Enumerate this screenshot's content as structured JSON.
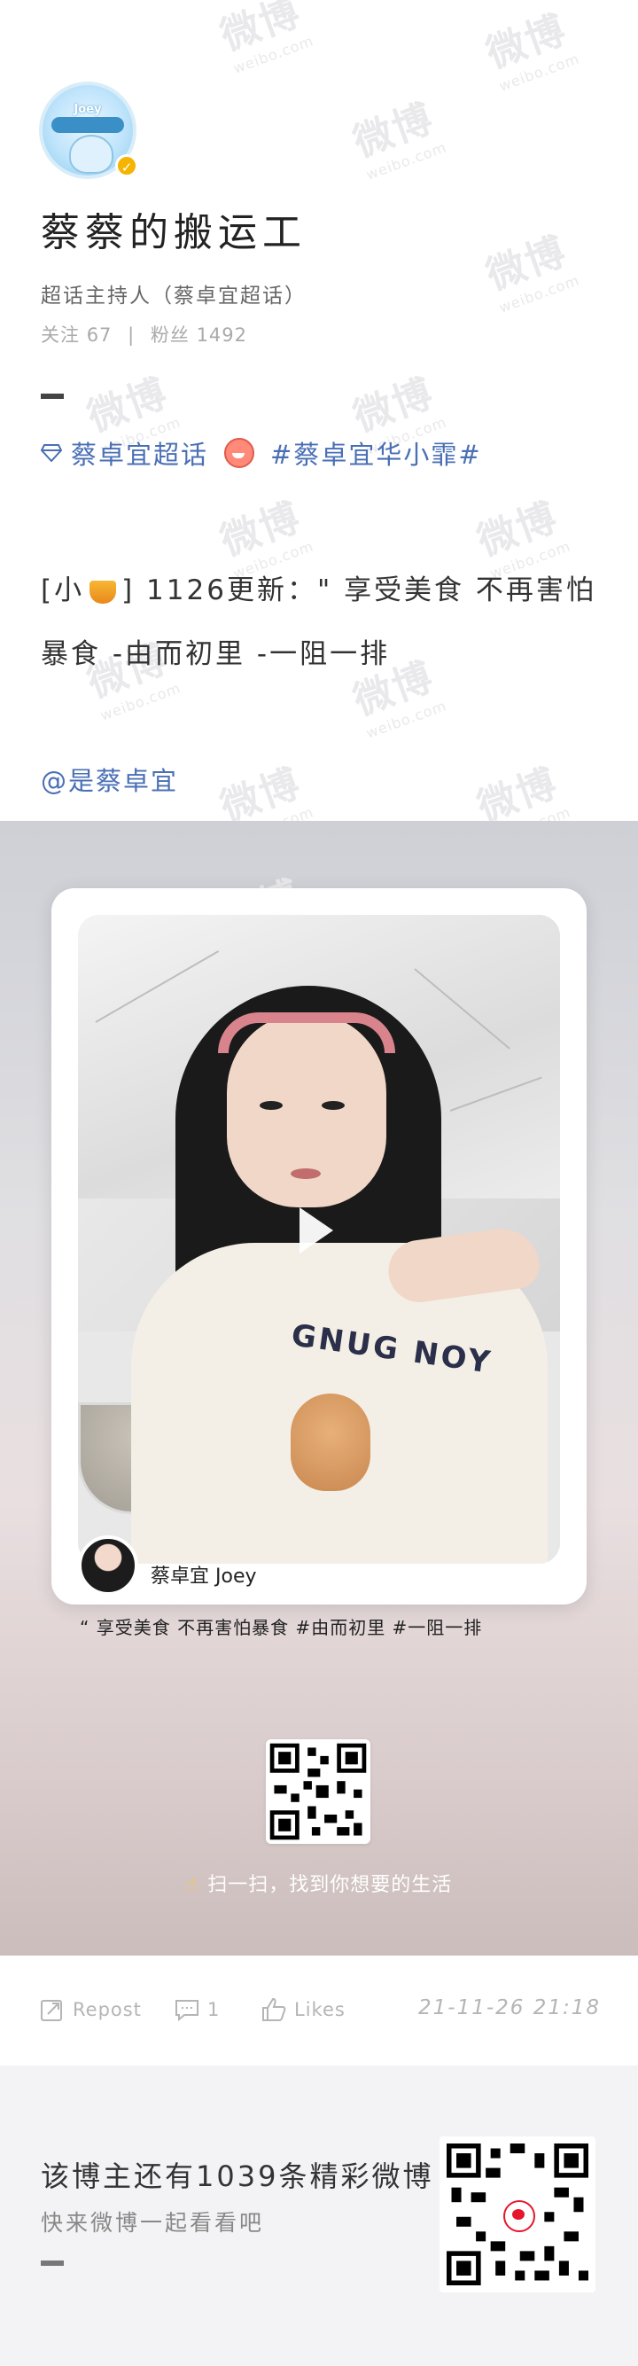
{
  "profile": {
    "avatar_label": "Joey",
    "username": "蔡蔡的搬运工",
    "role": "超话主持人（蔡卓宜超话）",
    "follow_label": "关注",
    "follow_count": "67",
    "fans_label": "粉丝",
    "fans_count": "1492"
  },
  "post": {
    "topic_super": "蔡卓宜超话",
    "topic_hashtag": "#蔡卓宜华小霏#",
    "text_prefix": "[小",
    "text_body": "] 1126更新：\" 享受美食 不再害怕暴食 -由而初里 -一阻一排",
    "mention": "@是蔡卓宜"
  },
  "video_card": {
    "user_name": "蔡卓宜 Joey",
    "caption": "“ 享受美食 不再害怕暴食 #由而初里 #一阻一排",
    "sweater_text": "GNUG NOY",
    "scan_text": "扫一扫，找到你想要的生活"
  },
  "actions": {
    "repost_label": "Repost",
    "comment_count": "1",
    "likes_label": "Likes",
    "datetime": "21-11-26 21:18"
  },
  "footer": {
    "title": "该博主还有1039条精彩微博",
    "subtitle": "快来微博一起看看吧"
  },
  "watermark": {
    "text": "微博",
    "sub": "weibo.com"
  },
  "colors": {
    "link": "#4a6fb5",
    "verified": "#f4b400",
    "weibo_red": "#e6162d"
  }
}
